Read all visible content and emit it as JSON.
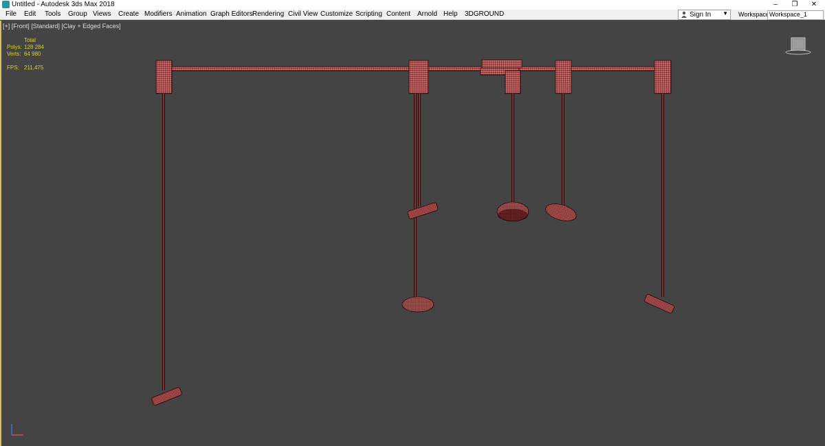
{
  "window": {
    "title": "Untitled - Autodesk 3ds Max 2018",
    "controls": [
      "–",
      "❐",
      "✕"
    ]
  },
  "menu": [
    "File",
    "Edit",
    "Tools",
    "Group",
    "Views",
    "Create",
    "Modifiers",
    "Animation",
    "Graph Editors",
    "Rendering",
    "Civil View",
    "Customize",
    "Scripting",
    "Content",
    "Arnold",
    "Help",
    "3DGROUND"
  ],
  "account": {
    "sign_in": "Sign In"
  },
  "workspaces": {
    "label": "Workspaces:",
    "value": "Workspace_1"
  },
  "viewport": {
    "labels": [
      "[+]",
      "[Front]",
      "[Standard]",
      "[Clay + Edged Faces]"
    ],
    "stats": {
      "header": "Total",
      "polys_label": "Polys:",
      "polys_value": "128 284",
      "verts_label": "Verts:",
      "verts_value": "64 980",
      "fps_label": "FPS:",
      "fps_value": "211,475"
    },
    "viewcube": "front-view-cube-icon",
    "colors": {
      "background": "#444444",
      "model": "#c96868",
      "wire": "#3a0505",
      "stats": "#d8d130",
      "active_border": "#d9c15a"
    }
  }
}
